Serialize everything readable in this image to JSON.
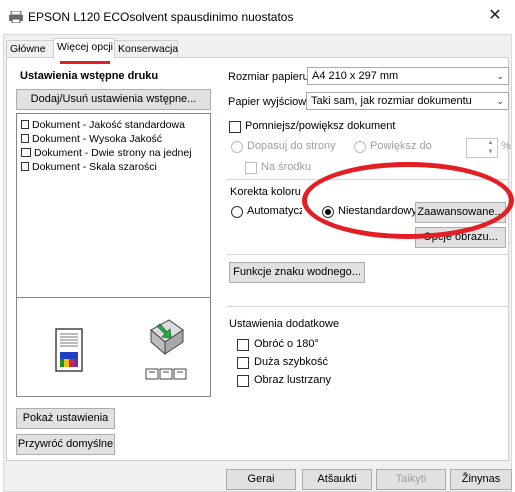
{
  "window": {
    "title": "EPSON L120 ECOsolvent spausdinimo nuostatos",
    "close_glyph": "✕"
  },
  "tabs": [
    {
      "label": "Główne"
    },
    {
      "label": "Więcej opcji"
    },
    {
      "label": "Konserwacja"
    }
  ],
  "presets": {
    "heading": "Ustawienia wstępne druku",
    "add_remove_button": "Dodaj/Usuń ustawienia wstępne...",
    "items": [
      {
        "label": "Dokument - Jakość standardowa",
        "icon": "document-icon"
      },
      {
        "label": "Dokument - Wysoka Jakość",
        "icon": "document-icon"
      },
      {
        "label": "Dokument - Dwie strony na jednej",
        "icon": "two-page-document-icon"
      },
      {
        "label": "Dokument - Skala szarości",
        "icon": "document-icon"
      }
    ]
  },
  "paper": {
    "size_label": "Rozmiar papieru",
    "size_value": "A4 210 x 297 mm",
    "output_label": "Papier wyjściowy",
    "output_value": "Taki sam, jak rozmiar dokumentu"
  },
  "scale": {
    "checkbox_label": "Pomniejsz/powiększ dokument",
    "fit_to_page": "Dopasuj do strony",
    "zoom_to": "Powiększ do",
    "percent": "%",
    "center": "Na środku"
  },
  "color": {
    "heading": "Korekta koloru",
    "automatic": "Automatyczn",
    "custom": "Niestandardowy",
    "advanced_button": "Zaawansowane...",
    "options_button": "Opcje obrazu..."
  },
  "watermark_button": "Funkcje znaku wodnego...",
  "additional": {
    "heading": "Ustawienia dodatkowe",
    "rotate": "Obróć o 180°",
    "high_speed": "Duża szybkość",
    "mirror": "Obraz lustrzany"
  },
  "left_buttons": {
    "show_settings": "Pokaż ustawienia",
    "restore_defaults": "Przywróć domyślne"
  },
  "bottom_buttons": {
    "ok": "Gerai",
    "cancel": "Atšaukti",
    "apply": "Taikyti",
    "help": "Žinynas"
  },
  "annotation_color": "#e31e24"
}
